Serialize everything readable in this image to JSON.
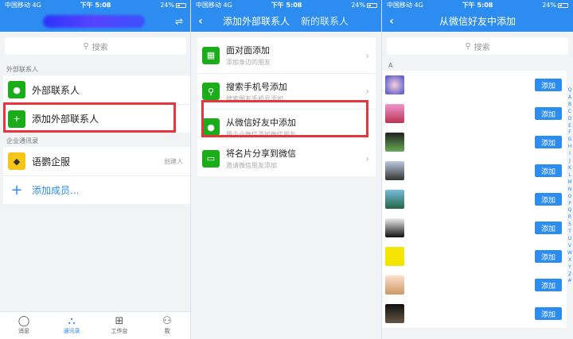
{
  "status": {
    "carrier": "中国移动 4G",
    "time": "下午 5:08",
    "battery": "24%"
  },
  "panel1": {
    "search": "搜索",
    "section_external": "外部联系人",
    "row_external": "外部联系人",
    "row_add_external": "添加外部联系人",
    "section_enterprise": "企业通讯录",
    "company": "语鹦企服",
    "company_tag": "创建人",
    "add_member": "添加成员...",
    "tabs": [
      {
        "icon": "message-icon",
        "label": "消息"
      },
      {
        "icon": "contacts-icon",
        "label": "通讯录"
      },
      {
        "icon": "workbench-icon",
        "label": "工作台"
      },
      {
        "icon": "me-icon",
        "label": "我"
      }
    ]
  },
  "panel2": {
    "tab_active": "添加外部联系人",
    "tab_other": "新的联系人",
    "items": [
      {
        "title": "面对面添加",
        "sub": "添加身边的朋友"
      },
      {
        "title": "搜索手机号添加",
        "sub": "搜索朋友手机号添加"
      },
      {
        "title": "从微信好友中添加",
        "sub": "用企业微信添加微信朋友"
      },
      {
        "title": "将名片分享到微信",
        "sub": "邀请微信朋友添加"
      }
    ]
  },
  "panel3": {
    "title": "从微信好友中添加",
    "search": "搜索",
    "letter": "A",
    "add_label": "添加",
    "index": [
      "Q",
      "A",
      "B",
      "C",
      "D",
      "E",
      "F",
      "G",
      "H",
      "I",
      "J",
      "K",
      "L",
      "M",
      "N",
      "O",
      "P",
      "Q",
      "R",
      "S",
      "T",
      "U",
      "V",
      "W",
      "X",
      "Y",
      "Z",
      "#"
    ]
  },
  "colors": {
    "brand_blue": "#2d8cf0",
    "highlight_red": "#e8343c",
    "wechat_green": "#1aad19"
  }
}
